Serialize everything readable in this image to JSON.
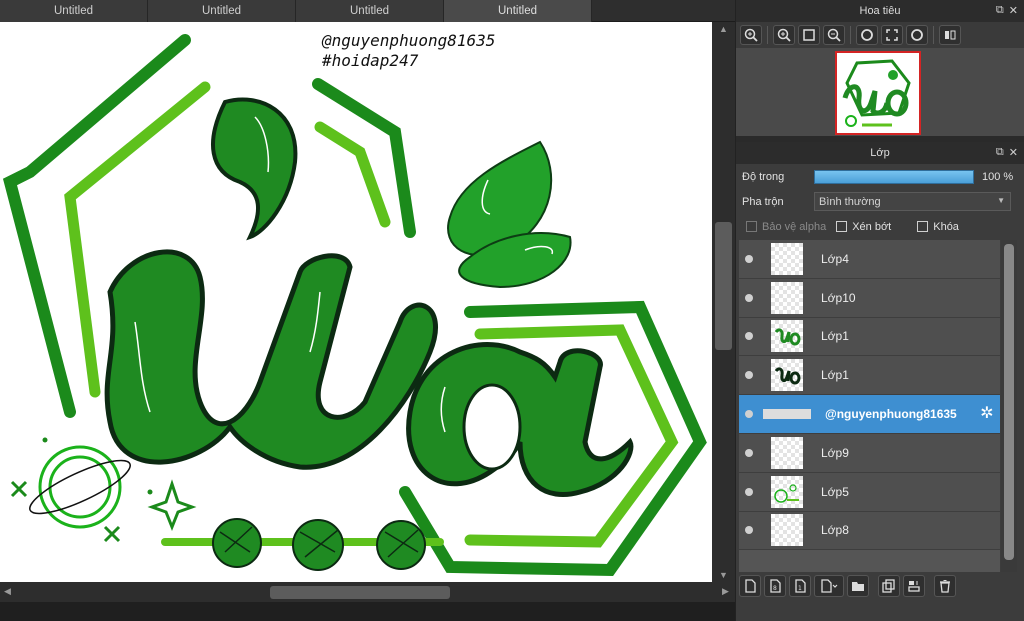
{
  "tabs": [
    {
      "label": "Untitled"
    },
    {
      "label": "Untitled"
    },
    {
      "label": "Untitled"
    },
    {
      "label": "Untitled",
      "active": true
    }
  ],
  "canvas": {
    "signature_line1": "@nguyenphuong81635",
    "signature_line2": "#hoidap247",
    "artwork_text": "ửa",
    "colors": {
      "dark_green": "#1b7a1b",
      "mid_green": "#2b9a24",
      "light_green": "#5ec11c",
      "outline": "#0c2a12"
    }
  },
  "navigator": {
    "title": "Hoa tiêu",
    "tools": [
      "zoom-in-icon",
      "zoom-in-small-icon",
      "fit-icon",
      "zoom-out-icon",
      "rotate-left-icon",
      "fullscreen-icon",
      "rotate-right-icon",
      "flip-icon"
    ]
  },
  "layers_panel": {
    "title": "Lớp",
    "opacity_label": "Độ trong",
    "opacity_value": "100 %",
    "opacity_fraction": 1.0,
    "blend_label": "Pha trộn",
    "blend_value": "Bình thường",
    "protect_alpha": "Bảo vệ alpha",
    "clipping": "Xén bớt",
    "lock": "Khóa",
    "layers": [
      {
        "name": "Lớp4",
        "thumb": "empty"
      },
      {
        "name": "Lớp10",
        "thumb": "empty"
      },
      {
        "name": "Lớp1",
        "thumb": "art"
      },
      {
        "name": "Lớp1",
        "thumb": "art-dark"
      },
      {
        "name": "@nguyenphuong81635",
        "thumb": "text",
        "selected": true
      },
      {
        "name": "Lớp9",
        "thumb": "empty"
      },
      {
        "name": "Lớp5",
        "thumb": "sketch"
      },
      {
        "name": "Lớp8",
        "thumb": "empty"
      }
    ]
  },
  "accent_color": "#3e8fd1"
}
